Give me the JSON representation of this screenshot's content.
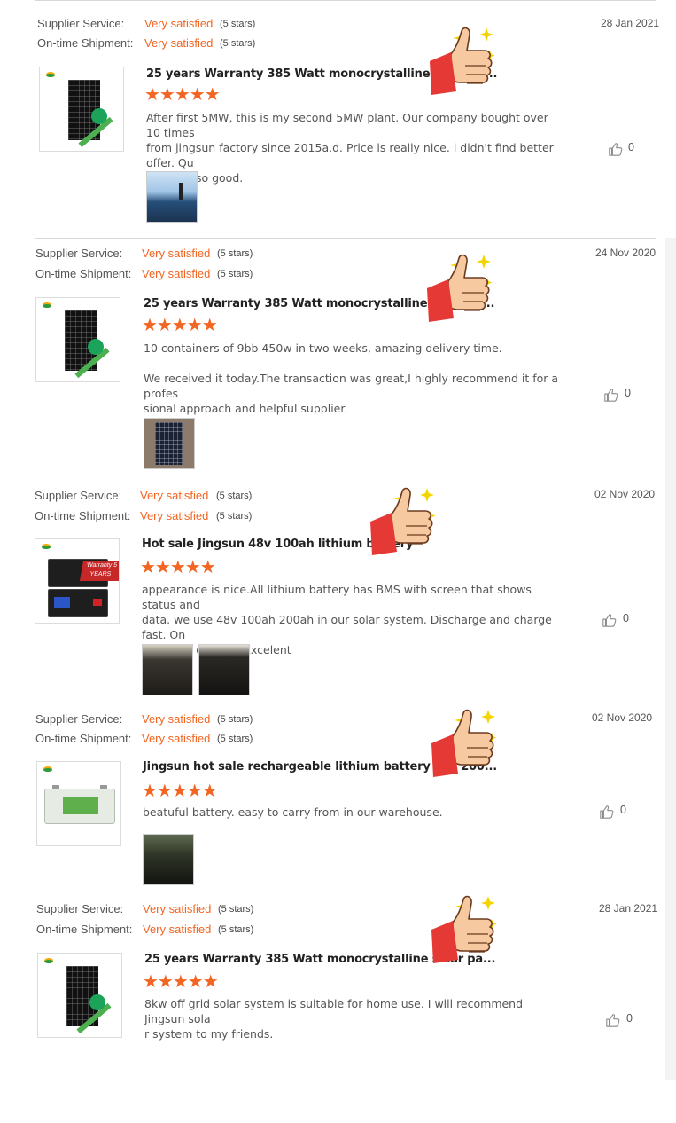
{
  "labels": {
    "supplier_service": "Supplier Service:",
    "ontime_shipment": "On-time Shipment:",
    "rating_word": "Very satisfied",
    "rating_stars": "(5 stars)"
  },
  "colors": {
    "accent": "#f26522",
    "divider": "#d8d8d8"
  },
  "reviews": [
    {
      "date": "28 Jan 2021",
      "product_title": "25 years Warranty 385 Watt monocrystalline solar pa...",
      "rating": 5,
      "text": "After first 5MW, this is my second 5MW plant. Our company bought over 10 times\nfrom jingsun factory since 2015a.d. Price is really nice. i didn't find better offer. Qu\nality is also good.",
      "likes": "0",
      "product_icon": "solar-panel",
      "photos": [
        "solar-site-photo"
      ]
    },
    {
      "date": "24 Nov 2020",
      "product_title": "25 years Warranty 385 Watt monocrystalline solar pa...",
      "rating": 5,
      "text": "10 containers of 9bb 450w in two weeks, amazing delivery time.\n\nWe received it today.The transaction was great,I highly recommend it for a profes\nsional approach and helpful supplier.",
      "likes": "0",
      "product_icon": "solar-panel",
      "photos": [
        "panel-photo"
      ]
    },
    {
      "date": "02 Nov 2020",
      "product_title": "Hot sale Jingsun 48v 100ah lithium battery",
      "rating": 5,
      "text": "appearance is nice.All lithium battery has BMS with screen that shows status and\ndata. we use 48v 100ah 200ah in our solar system. Discharge and charge fast. On\ne battery one box.Excelent",
      "likes": "0",
      "product_icon": "lithium-battery",
      "product_tag": "Warranty 5 YEARS",
      "photos": [
        "battery-photo-1",
        "battery-photo-2"
      ]
    },
    {
      "date": "02 Nov 2020",
      "product_title": "Jingsun hot sale rechargeable lithium battery 12v 200...",
      "rating": 5,
      "text": "beatuful battery. easy to carry from in our warehouse.",
      "likes": "0",
      "product_icon": "12v-battery",
      "photos": [
        "warehouse-photo"
      ]
    },
    {
      "date": "28 Jan 2021",
      "product_title": "25 years Warranty 385 Watt monocrystalline solar pa...",
      "rating": 5,
      "text": "8kw off grid solar system is suitable for home use. I will recommend Jingsun sola\nr system to my friends.",
      "likes": "0",
      "product_icon": "solar-panel",
      "photos": []
    }
  ]
}
